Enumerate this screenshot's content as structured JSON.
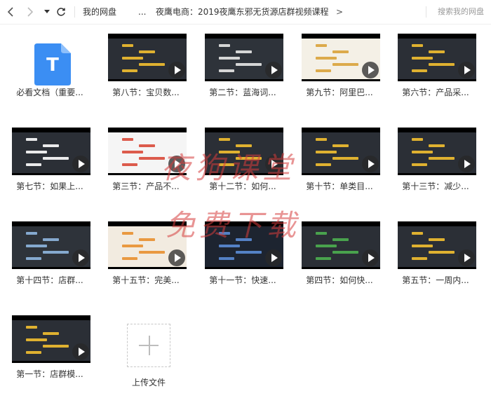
{
  "topbar": {
    "back_icon": "chevron-left-icon",
    "forward_icon": "chevron-right-icon",
    "dropdown_icon": "caret-down-icon",
    "refresh_icon": "refresh-icon",
    "breadcrumb_root": "我的网盘",
    "breadcrumb_ellipsis": "...",
    "breadcrumb_current": "夜鹰电商：2019夜鹰东邪无货源店群视频课程",
    "breadcrumb_sep": ">",
    "search_placeholder": "搜索我的网盘"
  },
  "files": [
    {
      "label": "必看文档（重要...",
      "type": "doc"
    },
    {
      "label": "第八节：宝贝数...",
      "type": "video"
    },
    {
      "label": "第二节：蓝海词...",
      "type": "video"
    },
    {
      "label": "第九节：阿里巴...",
      "type": "video"
    },
    {
      "label": "第六节：产品采...",
      "type": "video"
    },
    {
      "label": "第七节：如果上...",
      "type": "video"
    },
    {
      "label": "第三节：产品不...",
      "type": "video"
    },
    {
      "label": "第十二节：如何...",
      "type": "video"
    },
    {
      "label": "第十节：单类目...",
      "type": "video"
    },
    {
      "label": "第十三节：减少...",
      "type": "video"
    },
    {
      "label": "第十四节：店群...",
      "type": "video"
    },
    {
      "label": "第十五节：完美...",
      "type": "video"
    },
    {
      "label": "第十一节：快速...",
      "type": "video"
    },
    {
      "label": "第四节：如何快...",
      "type": "video"
    },
    {
      "label": "第五节：一周内...",
      "type": "video"
    },
    {
      "label": "第一节：店群模...",
      "type": "video"
    }
  ],
  "upload": {
    "label": "上传文件",
    "icon": "plus-icon"
  },
  "doc_icon_letter": "T",
  "watermark": {
    "line1": "夜狗课堂",
    "line2": "免费下载"
  },
  "colors": {
    "doc_blue": "#3b8ef3",
    "watermark": "#d63c3c"
  }
}
